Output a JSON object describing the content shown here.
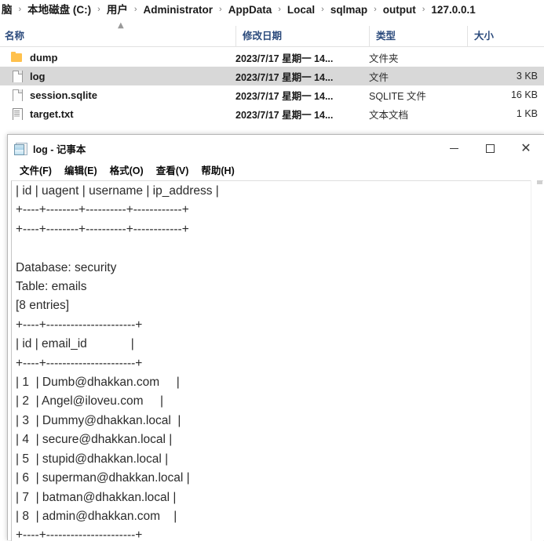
{
  "breadcrumb": {
    "items": [
      "脑",
      "本地磁盘 (C:)",
      "用户",
      "Administrator",
      "AppData",
      "Local",
      "sqlmap",
      "output",
      "127.0.0.1"
    ],
    "separator": "›"
  },
  "columns": {
    "name": "名称",
    "date": "修改日期",
    "type": "类型",
    "size": "大小",
    "sort_caret": "⌃"
  },
  "files": [
    {
      "name": "dump",
      "date": "2023/7/17 星期一 14...",
      "type": "文件夹",
      "size": "",
      "icon": "folder-icon",
      "selected": false
    },
    {
      "name": "log",
      "date": "2023/7/17 星期一 14...",
      "type": "文件",
      "size": "3 KB",
      "icon": "file-icon",
      "selected": true
    },
    {
      "name": "session.sqlite",
      "date": "2023/7/17 星期一 14...",
      "type": "SQLITE 文件",
      "size": "16 KB",
      "icon": "file-icon",
      "selected": false
    },
    {
      "name": "target.txt",
      "date": "2023/7/17 星期一 14...",
      "type": "文本文档",
      "size": "1 KB",
      "icon": "text-file-icon",
      "selected": false
    }
  ],
  "notepad": {
    "title": "log - 记事本",
    "icon": "notepad-icon",
    "window_controls": {
      "minimize": "—",
      "maximize": "▢",
      "close": "✕"
    },
    "menu": [
      "文件(F)",
      "编辑(E)",
      "格式(O)",
      "查看(V)",
      "帮助(H)"
    ],
    "content": "| id | uagent | username | ip_address |\n+----+--------+----------+------------+\n+----+--------+----------+------------+\n\nDatabase: security\nTable: emails\n[8 entries]\n+----+----------------------+\n| id | email_id             |\n+----+----------------------+\n| 1  | Dumb@dhakkan.com     |\n| 2  | Angel@iloveu.com     |\n| 3  | Dummy@dhakkan.local  |\n| 4  | secure@dhakkan.local |\n| 5  | stupid@dhakkan.local |\n| 6  | superman@dhakkan.local |\n| 7  | batman@dhakkan.local |\n| 8  | admin@dhakkan.com    |\n+----+----------------------+"
  },
  "colors": {
    "header_text": "#2b4a7c",
    "selection": "#d8d8d8",
    "folder": "#ffc14d",
    "text": "#2b2b2b"
  }
}
